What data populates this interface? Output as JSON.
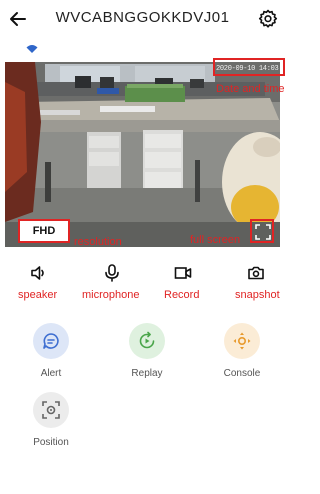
{
  "header": {
    "title": "WVCABNGGOKKDVJ01",
    "back_icon": "arrow-left-icon",
    "settings_icon": "gear-icon"
  },
  "status": {
    "wifi_icon": "wifi-icon"
  },
  "video": {
    "timestamp": "2020-09-10 14:03:43"
  },
  "annotations": {
    "date_time": "Date and time",
    "resolution": "resolution",
    "full_screen": "full screen",
    "speaker": "speaker",
    "microphone": "microphone",
    "record": "Record",
    "snapshot": "snapshot"
  },
  "resolution": {
    "label": "FHD"
  },
  "controls": {
    "speaker_icon": "speaker-icon",
    "microphone_icon": "microphone-icon",
    "record_icon": "video-camera-icon",
    "snapshot_icon": "camera-icon"
  },
  "features": [
    {
      "label": "Alert",
      "icon": "message-icon",
      "bg": "#dde6f7",
      "fg": "#3f6fd1"
    },
    {
      "label": "Replay",
      "icon": "replay-icon",
      "bg": "#dff1df",
      "fg": "#4aa54a"
    },
    {
      "label": "Console",
      "icon": "direction-pad-icon",
      "bg": "#fbecd6",
      "fg": "#e89a2c"
    },
    {
      "label": "Position",
      "icon": "target-icon",
      "bg": "#ececec",
      "fg": "#666666"
    }
  ],
  "colors": {
    "annotation": "#e02424",
    "wifi": "#2f66c9"
  }
}
